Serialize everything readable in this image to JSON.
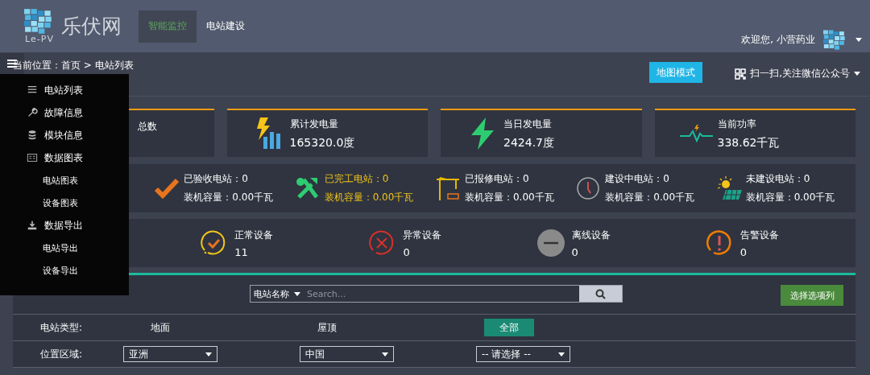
{
  "header": {
    "logo_text": "乐伏网",
    "logo_subtext": "Le-PV",
    "nav": [
      {
        "label": "智能监控",
        "selected": true
      },
      {
        "label": "电站建设",
        "selected": false
      }
    ],
    "welcome": "欢迎您, 小营药业"
  },
  "toolbar": {
    "breadcrumb": "当前位置：首页 > 电站列表",
    "map_button": "地图模式",
    "wechat_link": "扫一扫,关注微信公众号"
  },
  "side_menu": {
    "items": [
      {
        "label": "电站列表"
      },
      {
        "label": "故障信息"
      },
      {
        "label": "模块信息"
      },
      {
        "label": "数据图表",
        "children": [
          {
            "label": "电站图表"
          },
          {
            "label": "设备图表"
          }
        ]
      },
      {
        "label": "数据导出",
        "children": [
          {
            "label": "电站导出"
          },
          {
            "label": "设备导出"
          }
        ]
      }
    ]
  },
  "kpi_cards": [
    {
      "title": "总数"
    },
    {
      "title": "累计发电量",
      "value": "165320.0度"
    },
    {
      "title": "当日发电量",
      "value": "2424.7度"
    },
    {
      "title": "当前功率",
      "value": "338.62千瓦"
    }
  ],
  "station_status": [
    {
      "label": "已验收电站：0",
      "capacity": "装机容量：0.00千瓦",
      "highlighted": false
    },
    {
      "label": "已完工电站：0",
      "capacity": "装机容量：0.00千瓦",
      "highlighted": true
    },
    {
      "label": "已报修电站：0",
      "capacity": "装机容量：0.00千瓦",
      "highlighted": false
    },
    {
      "label": "建设中电站：0",
      "capacity": "装机容量：0.00千瓦",
      "highlighted": false
    },
    {
      "label": "未建设电站：0",
      "capacity": "装机容量：0.00千瓦",
      "highlighted": false
    }
  ],
  "devices": [
    {
      "label": "正常设备",
      "value": "11"
    },
    {
      "label": "异常设备",
      "value": "0"
    },
    {
      "label": "离线设备",
      "value": "0"
    },
    {
      "label": "告警设备",
      "value": "0"
    }
  ],
  "search": {
    "field_select": "电站名称",
    "placeholder": "Search...",
    "column_button": "选择选项列"
  },
  "filters": {
    "type_label": "电站类型:",
    "types": [
      {
        "label": "地面",
        "selected": false
      },
      {
        "label": "屋顶",
        "selected": false
      },
      {
        "label": "全部",
        "selected": true
      }
    ],
    "region_label": "位置区域:",
    "regions": [
      {
        "value": "亚洲"
      },
      {
        "value": "中国"
      },
      {
        "value": "-- 请选择 --"
      }
    ]
  }
}
